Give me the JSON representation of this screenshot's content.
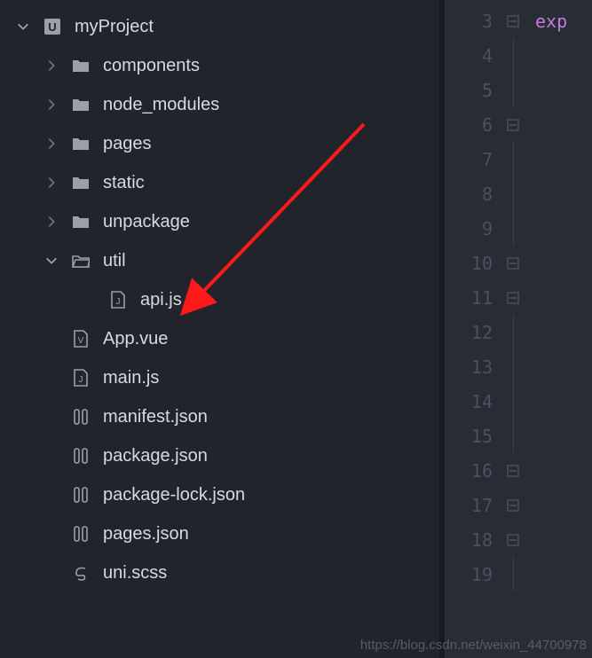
{
  "tree": {
    "root": {
      "name": "myProject",
      "expanded": true
    },
    "children": [
      {
        "name": "components",
        "type": "folder",
        "expanded": false
      },
      {
        "name": "node_modules",
        "type": "folder",
        "expanded": false
      },
      {
        "name": "pages",
        "type": "folder",
        "expanded": false
      },
      {
        "name": "static",
        "type": "folder",
        "expanded": false
      },
      {
        "name": "unpackage",
        "type": "folder",
        "expanded": false
      },
      {
        "name": "util",
        "type": "folder",
        "expanded": true,
        "children": [
          {
            "name": "api.js",
            "type": "js"
          }
        ]
      },
      {
        "name": "App.vue",
        "type": "vue"
      },
      {
        "name": "main.js",
        "type": "js"
      },
      {
        "name": "manifest.json",
        "type": "json"
      },
      {
        "name": "package.json",
        "type": "json"
      },
      {
        "name": "package-lock.json",
        "type": "json"
      },
      {
        "name": "pages.json",
        "type": "json"
      },
      {
        "name": "uni.scss",
        "type": "scss"
      }
    ]
  },
  "editor": {
    "lines": [
      {
        "num": 3,
        "fold": "minus",
        "text": "exp",
        "cls": "kw-purple"
      },
      {
        "num": 4,
        "fold": "line",
        "text": ""
      },
      {
        "num": 5,
        "fold": "line",
        "text": ""
      },
      {
        "num": 6,
        "fold": "minus",
        "text": ""
      },
      {
        "num": 7,
        "fold": "line",
        "text": ""
      },
      {
        "num": 8,
        "fold": "line",
        "text": ""
      },
      {
        "num": 9,
        "fold": "line",
        "text": ""
      },
      {
        "num": 10,
        "fold": "minus",
        "text": ""
      },
      {
        "num": 11,
        "fold": "minus",
        "text": ""
      },
      {
        "num": 12,
        "fold": "line",
        "text": ""
      },
      {
        "num": 13,
        "fold": "line",
        "text": ""
      },
      {
        "num": 14,
        "fold": "line",
        "text": ""
      },
      {
        "num": 15,
        "fold": "line",
        "text": ""
      },
      {
        "num": 16,
        "fold": "minus",
        "text": ""
      },
      {
        "num": 17,
        "fold": "minus",
        "text": ""
      },
      {
        "num": 18,
        "fold": "minus",
        "text": ""
      },
      {
        "num": 19,
        "fold": "line",
        "text": ""
      }
    ]
  },
  "watermark": "https://blog.csdn.net/weixin_44700978"
}
